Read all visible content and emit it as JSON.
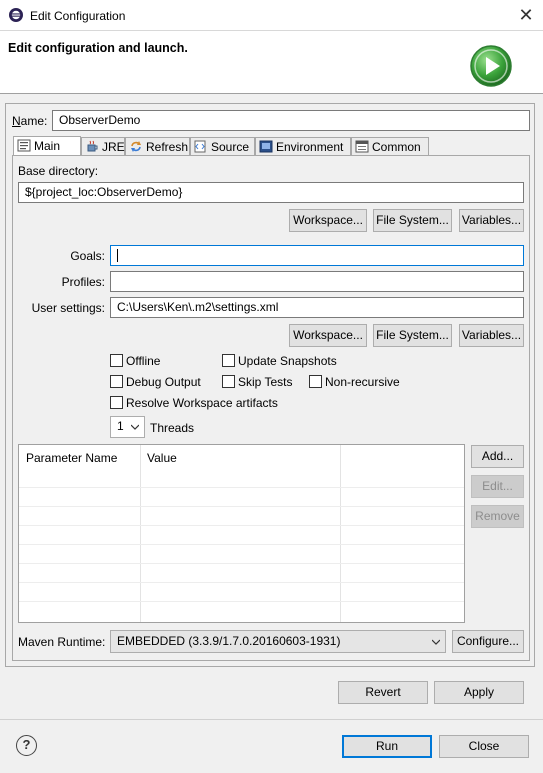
{
  "window": {
    "title": "Edit Configuration",
    "close_glyph": "✕"
  },
  "banner": {
    "title": "Edit configuration and launch."
  },
  "name": {
    "label": "Name:",
    "value": "ObserverDemo"
  },
  "tabs": [
    {
      "label": "Main",
      "icon": "main-tab-icon"
    },
    {
      "label": "JRE",
      "icon": "jre-icon"
    },
    {
      "label": "Refresh",
      "icon": "refresh-icon"
    },
    {
      "label": "Source",
      "icon": "source-icon"
    },
    {
      "label": "Environment",
      "icon": "environment-icon"
    },
    {
      "label": "Common",
      "icon": "common-icon"
    }
  ],
  "main": {
    "base_directory_label": "Base directory:",
    "base_directory_value": "${project_loc:ObserverDemo}",
    "workspace_btn": "Workspace...",
    "filesystem_btn": "File System...",
    "variables_btn": "Variables...",
    "goals_label": "Goals:",
    "goals_value": "",
    "profiles_label": "Profiles:",
    "profiles_value": "",
    "user_settings_label": "User settings:",
    "user_settings_value": "C:\\Users\\Ken\\.m2\\settings.xml",
    "options": {
      "offline": "Offline",
      "update_snapshots": "Update Snapshots",
      "debug_output": "Debug Output",
      "skip_tests": "Skip Tests",
      "non_recursive": "Non-recursive",
      "resolve_workspace": "Resolve Workspace artifacts"
    },
    "threads_value": "1",
    "threads_label": "Threads",
    "params": {
      "col_name": "Parameter Name",
      "col_value": "Value"
    },
    "add_btn": "Add...",
    "edit_btn": "Edit...",
    "remove_btn": "Remove",
    "maven_runtime_label": "Maven Runtime:",
    "maven_runtime_value": "EMBEDDED (3.3.9/1.7.0.20160603-1931)",
    "configure_btn": "Configure..."
  },
  "footer": {
    "revert_btn": "Revert",
    "apply_btn": "Apply",
    "run_btn": "Run",
    "close_btn": "Close",
    "help_glyph": "?"
  },
  "colors": {
    "accent": "#0078d7",
    "run_green": "#3aa23a"
  }
}
